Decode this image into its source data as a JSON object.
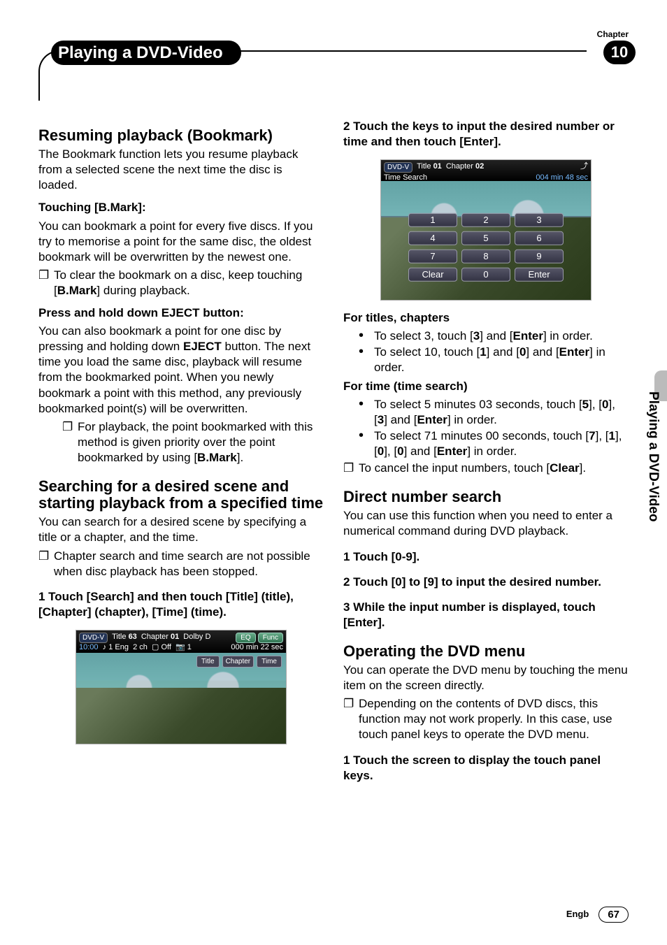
{
  "meta": {
    "chapter_label": "Chapter",
    "chapter_number": "10",
    "page_title": "Playing a DVD-Video",
    "side_title": "Playing a DVD-Video",
    "lang": "Engb",
    "page_number": "67"
  },
  "left": {
    "h1": "Resuming playback (Bookmark)",
    "p1": "The Bookmark function lets you resume playback from a selected scene the next time the disc is loaded.",
    "sub1": "Touching [B.Mark]:",
    "p2": "You can bookmark a point for every five discs. If you try to memorise a point for the same disc, the oldest bookmark will be overwritten by the newest one.",
    "note1a": "To clear the bookmark on a disc, keep touching [",
    "note1b": "B.Mark",
    "note1c": "] during playback.",
    "sub2a": "Press and hold down ",
    "sub2b": "EJECT",
    "sub2c": " button:",
    "p3a": "You can also bookmark a point for one disc by pressing and holding down ",
    "p3b": "EJECT",
    "p3c": " button. The next time you load the same disc, playback will resume from the bookmarked point. When you newly bookmark a point with this method, any previously bookmarked point(s) will be overwritten.",
    "note2a": "For playback, the point bookmarked with this method is given priority over the point bookmarked by using [",
    "note2b": "B.Mark",
    "note2c": "].",
    "h2": "Searching for a desired scene and starting playback from a specified time",
    "p4": "You can search for a desired scene by specifying a title or a chapter, and the time.",
    "note3": "Chapter search and time search are not possible when disc playback has been stopped.",
    "step1": "1    Touch [Search] and then touch [Title] (title), [Chapter] (chapter), [Time] (time).",
    "img1": {
      "title_label": "Title",
      "title_no": "63",
      "chapter_label": "Chapter",
      "chapter_no": "01",
      "dolby": "Dolby D",
      "eq": "EQ",
      "func": "Func",
      "time_counter": "000 min 22 sec",
      "audio": "1 Eng",
      "ch": "2 ch",
      "sub": "Off",
      "cam": "1",
      "clock": "10:00",
      "btn_title": "Title",
      "btn_chapter": "Chapter",
      "btn_time": "Time"
    }
  },
  "right": {
    "step2": "2    Touch the keys to input the desired number or time and then touch [Enter].",
    "img2": {
      "title_label": "Title",
      "title_no": "01",
      "chapter_label": "Chapter",
      "chapter_no": "02",
      "mode": "Time Search",
      "counter": "004 min 48 sec",
      "k1": "1",
      "k2": "2",
      "k3": "3",
      "k4": "4",
      "k5": "5",
      "k6": "6",
      "k7": "7",
      "k8": "8",
      "k9": "9",
      "clear": "Clear",
      "k0": "0",
      "enter": "Enter"
    },
    "sub_titles": "For titles, chapters",
    "b1a": "To select 3, touch [",
    "b1b": "3",
    "b1c": "] and [",
    "b1d": "Enter",
    "b1e": "] in order.",
    "b2a": "To select 10, touch [",
    "b2b": "1",
    "b2c": "] and [",
    "b2d": "0",
    "b2e": "] and [",
    "b2f": "Enter",
    "b2g": "] in order.",
    "sub_time": "For time (time search)",
    "b3a": "To select 5 minutes 03 seconds, touch [",
    "b3b": "5",
    "b3c": "], [",
    "b3d": "0",
    "b3e": "], [",
    "b3f": "3",
    "b3g": "] and [",
    "b3h": "Enter",
    "b3i": "] in order.",
    "b4a": "To select 71 minutes 00 seconds, touch [",
    "b4b": "7",
    "b4c": "], [",
    "b4d": "1",
    "b4e": "], [",
    "b4f": "0",
    "b4g": "], [",
    "b4h": "0",
    "b4i": "] and [",
    "b4j": "Enter",
    "b4k": "] in order.",
    "note4a": "To cancel the input numbers, touch [",
    "note4b": "Clear",
    "note4c": "].",
    "h3": "Direct number search",
    "p5": "You can use this function when you need to enter a numerical command during DVD playback.",
    "step3": "1    Touch [0-9].",
    "step4": "2    Touch [0] to [9] to input the desired number.",
    "step5": "3    While the input number is displayed, touch [Enter].",
    "h4": "Operating the DVD menu",
    "p6": "You can operate the DVD menu by touching the menu item on the screen directly.",
    "note5": "Depending on the contents of DVD discs, this function may not work properly. In this case, use touch panel keys to operate the DVD menu.",
    "step6": "1    Touch the screen to display the touch panel keys."
  }
}
